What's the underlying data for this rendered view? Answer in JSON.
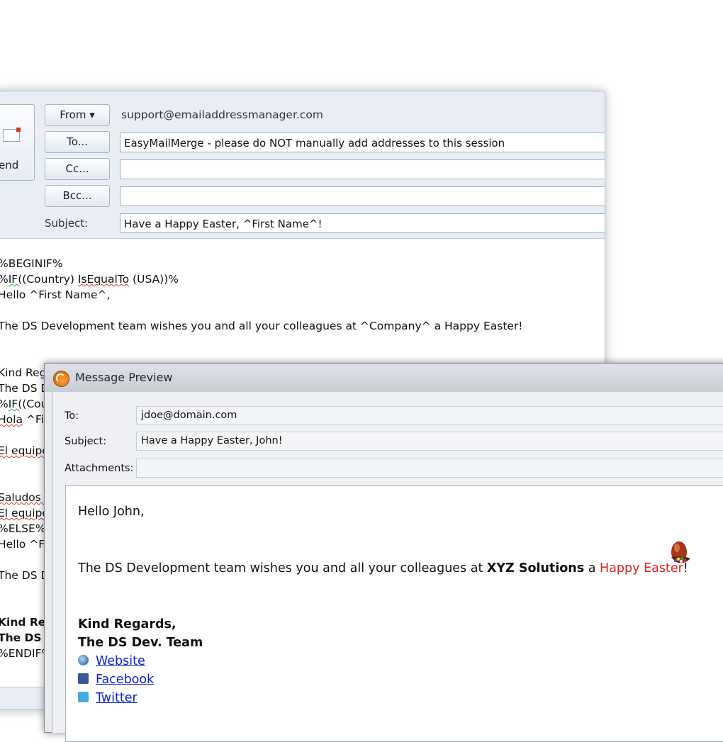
{
  "compose": {
    "send_label": "end",
    "from_button": "From ▾",
    "from_address": "support@emailaddressmanager.com",
    "to_button": "To...",
    "to_value": "EasyMailMerge - please do NOT manually add addresses to this session",
    "cc_button": "Cc...",
    "cc_value": "",
    "bcc_button": "Bcc...",
    "bcc_value": "",
    "subject_label": "Subject:",
    "subject_value": "Have a Happy Easter, ^First Name^!",
    "body": {
      "l1": "%BEGINIF%",
      "l2a": "%",
      "l2b": "IF(",
      "l2c": "(Country) ",
      "l2d": "IsEqualTo",
      "l2e": " (USA))%",
      "l3": "Hello ^First Name^,",
      "l4": "The DS Development team wishes you and all your colleagues at ^Company^ a Happy Easter!",
      "l5": "Kind Reg",
      "l6": "The DS D",
      "l7a": "%",
      "l7b": "IF(",
      "l7c": "(Cou",
      "l8a": "Hola",
      "l8b": " ^Fir",
      "l9": "El equipo",
      "l10": "Saludos c",
      "l11": "El equipo",
      "l12": "%ELSE%",
      "l13": "Hello ^Fi",
      "l14": "The DS D",
      "l15": "Kind Reg",
      "l16": "The DS D",
      "l17": "%ENDIF%"
    }
  },
  "preview": {
    "title": "Message Preview",
    "to_label": "To:",
    "to_value": "jdoe@domain.com",
    "subject_label": "Subject:",
    "subject_value": "Have a Happy Easter, John!",
    "attachments_label": "Attachments:",
    "attachments_value": "",
    "greeting": "Hello John,",
    "line_a": "The DS Development team wishes you and all your colleagues at ",
    "company": "XYZ Solutions",
    "line_b": " a ",
    "happy_easter": "Happy Easter",
    "line_c": "!",
    "sign1": "Kind Regards,",
    "sign2": "The DS Dev. Team",
    "link_website": "Website",
    "link_facebook": "Facebook",
    "link_twitter": "Twitter"
  }
}
